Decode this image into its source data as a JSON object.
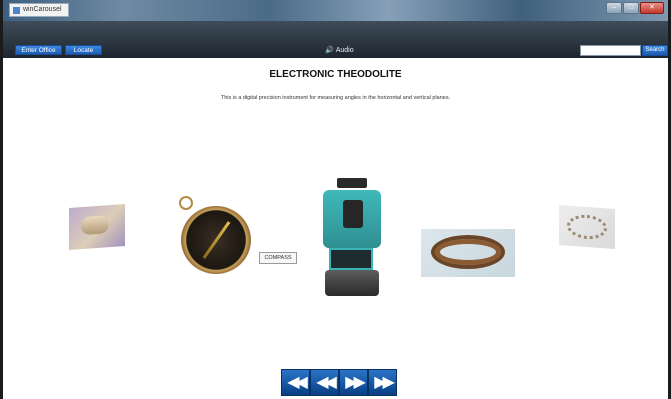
{
  "window": {
    "title": "winCarousel",
    "controls": [
      "minimize",
      "maximize",
      "close"
    ]
  },
  "toolbar": {
    "enter_office_label": "Enter Office",
    "locate_label": "Locate",
    "audio_label": "Audio",
    "search_value": "",
    "search_button_label": "Search"
  },
  "content": {
    "title": "ELECTRONIC THEODOLITE",
    "description": "This is a digital precision instrument for measuring angles in the horizontal and vertical planes."
  },
  "carousel": {
    "visible_label": "COMPASS",
    "items": [
      "scroll",
      "compass",
      "theodolite",
      "chain",
      "wire"
    ]
  },
  "navigation": {
    "first_icon": "first-icon",
    "prev_icon": "prev-icon",
    "next_icon": "next-icon",
    "last_icon": "last-icon"
  },
  "colors": {
    "accent": "#1d5cb3",
    "toolbar": "#1d262f"
  }
}
